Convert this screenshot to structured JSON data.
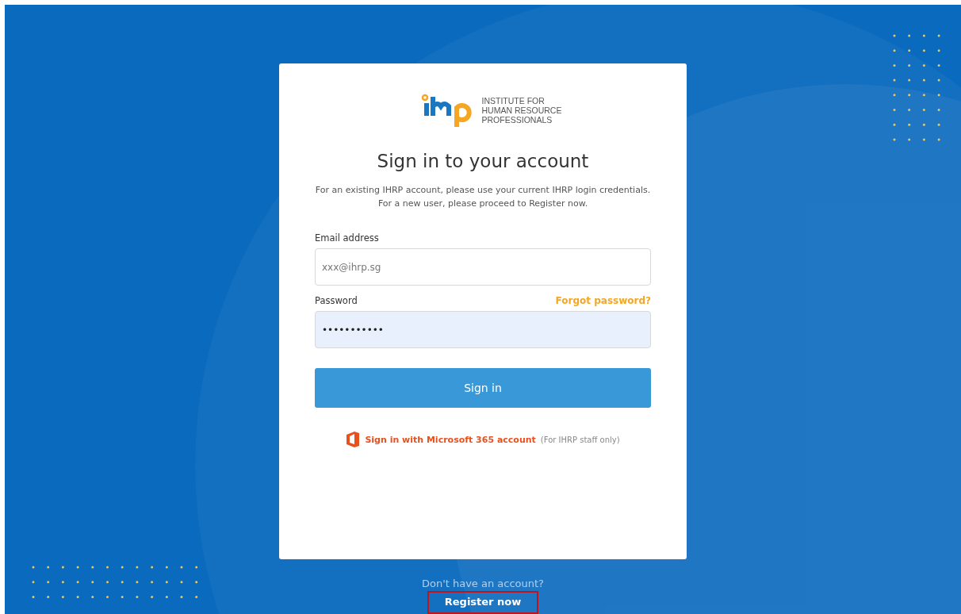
{
  "logo": {
    "text_lines": [
      "INSTITUTE FOR",
      "HUMAN RESOURCE",
      "PROFESSIONALS"
    ]
  },
  "title": "Sign in to your account",
  "intro_lines": [
    "For an existing IHRP account, please use your current IHRP login credentials.",
    "For a new user, please proceed to Register now."
  ],
  "email": {
    "label": "Email address",
    "placeholder": "xxx@ihrp.sg"
  },
  "password": {
    "label": "Password",
    "value": "•••••••••••",
    "forgot_link": "Forgot password?"
  },
  "sign_in_button": "Sign in",
  "microsoft": {
    "link": "Sign in with Microsoft 365 account",
    "note": "(For IHRP staff only)"
  },
  "footer": {
    "prompt": "Don't have an account?",
    "register_link": "Register now",
    "highlighted": true
  }
}
